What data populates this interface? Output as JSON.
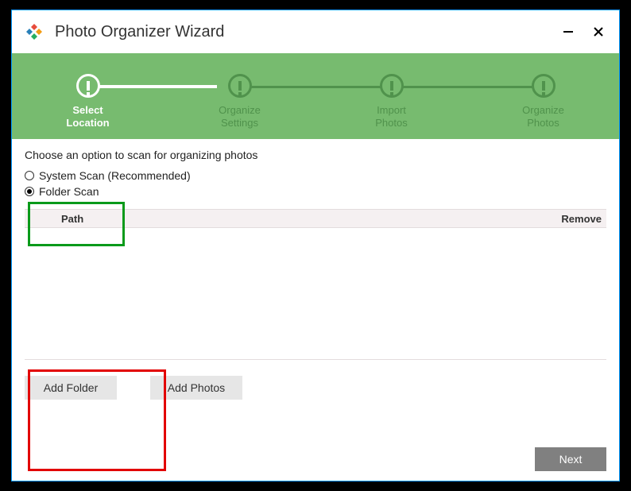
{
  "window": {
    "title": "Photo Organizer Wizard",
    "logo_name": "app-logo-icon"
  },
  "steps": [
    {
      "line1": "Select",
      "line2": "Location",
      "active": true
    },
    {
      "line1": "Organize",
      "line2": "Settings",
      "active": false
    },
    {
      "line1": "Import",
      "line2": "Photos",
      "active": false
    },
    {
      "line1": "Organize",
      "line2": "Photos",
      "active": false
    }
  ],
  "instruction": "Choose an option to scan for organizing photos",
  "options": {
    "system_scan": "System Scan (Recommended)",
    "folder_scan": "Folder Scan",
    "selected": "folder_scan"
  },
  "table": {
    "columns": {
      "path": "Path",
      "remove": "Remove"
    },
    "rows": []
  },
  "buttons": {
    "add_folder": "Add Folder",
    "add_photos": "Add Photos",
    "next": "Next"
  }
}
